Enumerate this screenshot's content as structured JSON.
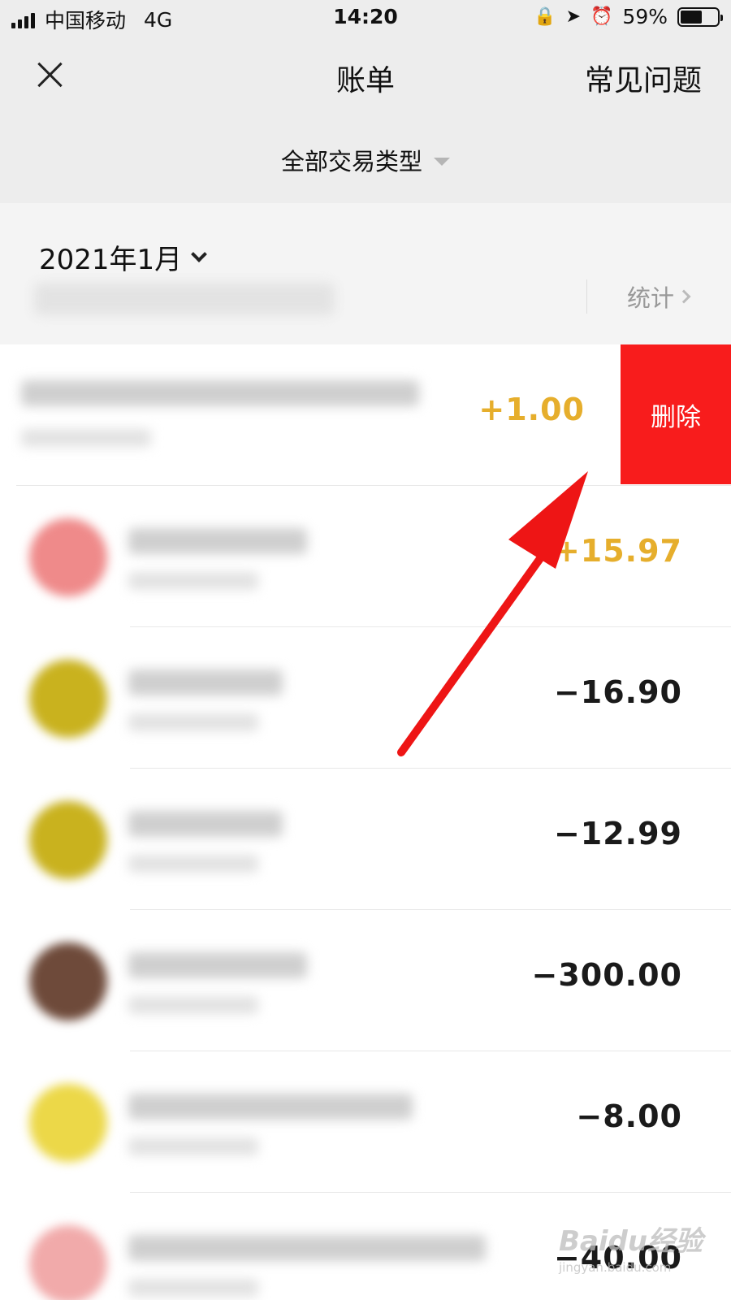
{
  "status_bar": {
    "carrier": "中国移动",
    "network": "4G",
    "time": "14:20",
    "battery": "59%",
    "battery_level": 0.59,
    "icons": [
      "lock-rotation-icon",
      "location-icon",
      "alarm-icon",
      "battery-icon"
    ]
  },
  "nav": {
    "title": "账单",
    "faq": "常见问题"
  },
  "filter": {
    "label": "全部交易类型"
  },
  "month": {
    "label": "2021年1月",
    "stats": "统计"
  },
  "colors": {
    "income": "#e6ae2c",
    "expense": "#1a1a1a",
    "delete": "#f81c1c",
    "annotation_arrow": "#ee1515"
  },
  "transactions": [
    {
      "amount": "+1.00",
      "type": "income",
      "avatar": "#f3a8a8",
      "delete_label": "删除"
    },
    {
      "amount": "+15.97",
      "type": "income",
      "avatar": "#ef8a8a"
    },
    {
      "amount": "−16.90",
      "type": "expense",
      "avatar": "#c9b21e"
    },
    {
      "amount": "−12.99",
      "type": "expense",
      "avatar": "#c9b21e"
    },
    {
      "amount": "−300.00",
      "type": "expense",
      "avatar": "#6e4a3a"
    },
    {
      "amount": "−8.00",
      "type": "expense",
      "avatar": "#ecd848"
    },
    {
      "amount": "−40.00",
      "type": "expense",
      "avatar": "#f1aaaa"
    }
  ],
  "watermark": {
    "logo": "Baidu经验",
    "url": "jingyan.baidu.com"
  }
}
